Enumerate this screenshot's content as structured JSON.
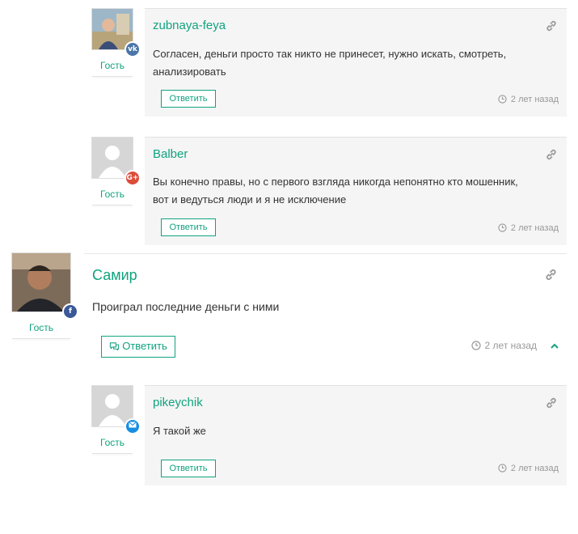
{
  "ui": {
    "reply_label": "Ответить",
    "guest_label": "Гость"
  },
  "comments": [
    {
      "author": "zubnaya-feya",
      "text_line1": "Согласен, деньги просто так никто не принесет, нужно искать, смотреть,",
      "text_line2": "анализировать",
      "time": "2 лет назад",
      "social": "vk",
      "social_color": "#4a76a8",
      "avatar": "photo"
    },
    {
      "author": "Balber",
      "text_line1": "Вы конечно правы, но с первого взгляда никогда непонятно кто мошенник,",
      "text_line2": "вот и ведуться люди и я не исключение",
      "time": "2 лет назад",
      "social": "google",
      "social_color": "#dd4b39",
      "avatar": "default"
    },
    {
      "author": "Самир",
      "text_line1": "Проиграл последние деньги с ними",
      "text_line2": "",
      "time": "2 лет назад",
      "social": "facebook",
      "social_color": "#3b5998",
      "avatar": "photo"
    },
    {
      "author": "pikeychik",
      "text_line1": "Я такой же",
      "text_line2": "",
      "time": "2 лет назад",
      "social": "mail",
      "social_color": "#168de2",
      "avatar": "default"
    }
  ],
  "colors": {
    "accent": "#10a37f",
    "card_bg": "#f5f5f5",
    "muted": "#999999"
  }
}
